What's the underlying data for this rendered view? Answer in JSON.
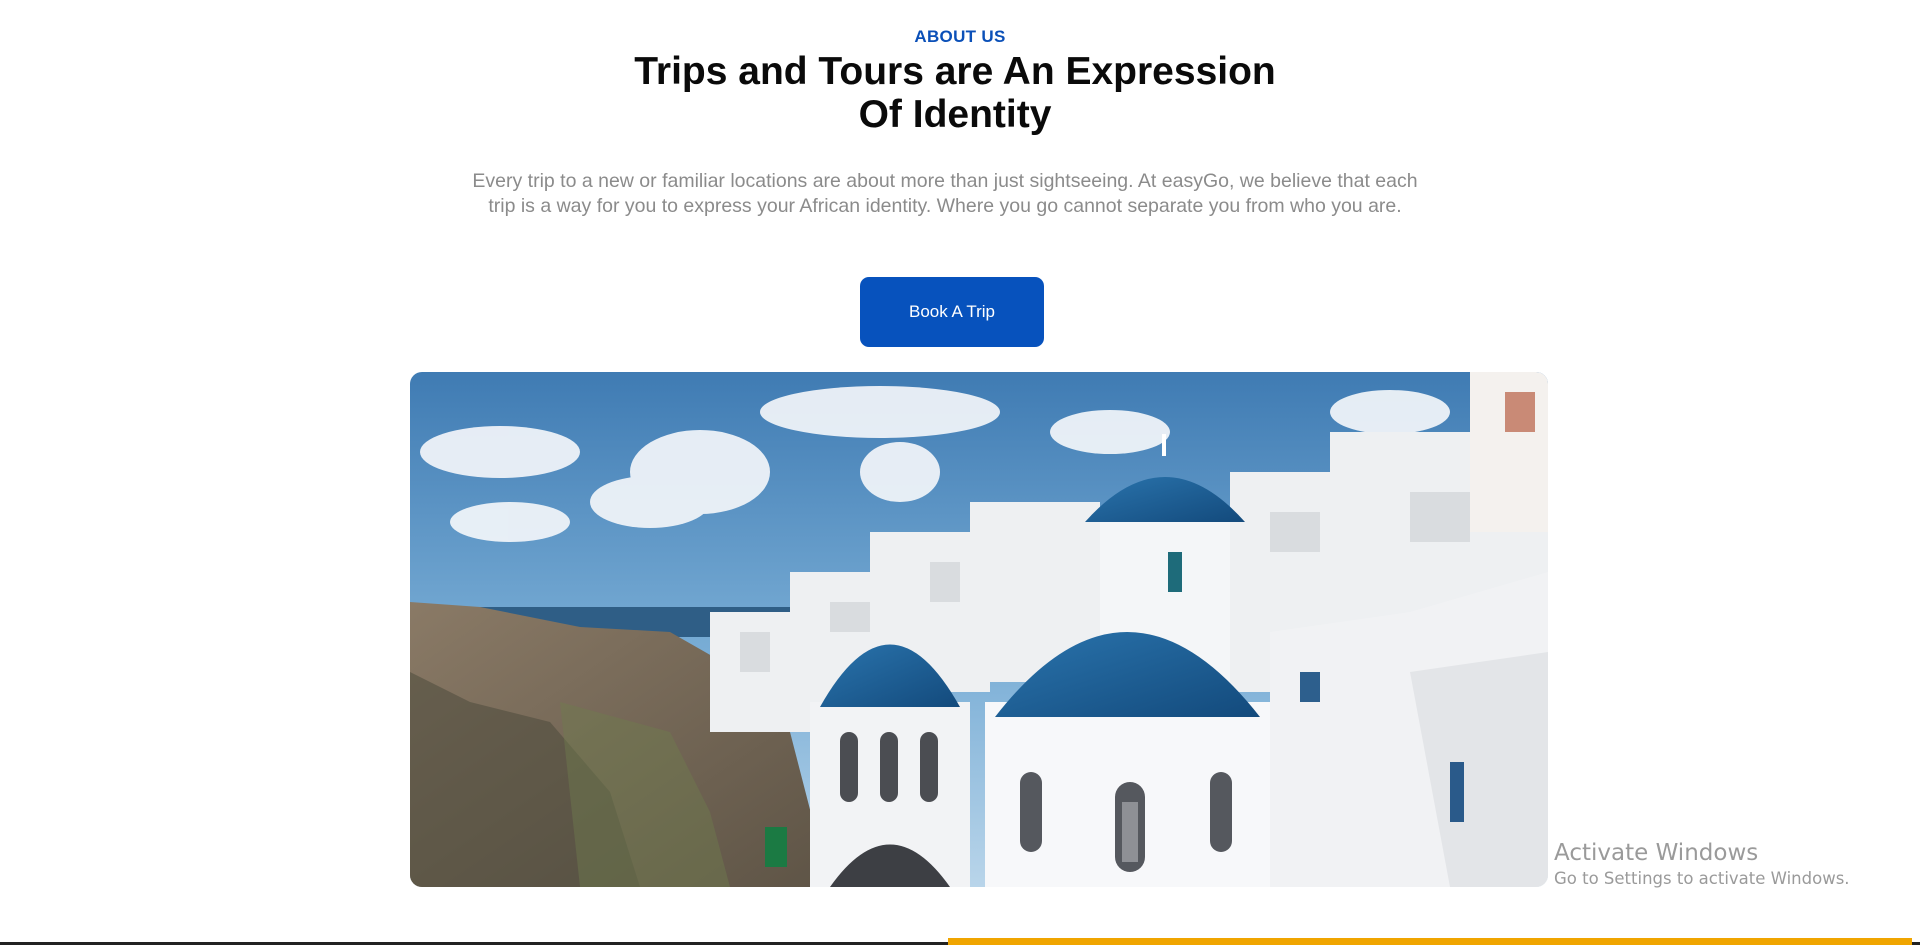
{
  "about": {
    "eyebrow": "ABOUT US",
    "title_line_1": "Trips and Tours are An Expression",
    "title_line_2": "Of Identity",
    "description": "Every trip to a new or familiar locations are about more than just sightseeing. At easyGo, we believe that each trip is a way for you to express your African identity. Where you go cannot separate you from who you are.",
    "cta_label": "Book A Trip"
  },
  "hero": {
    "subject": "Santorini blue-domed churches"
  },
  "watermark": {
    "title": "Activate Windows",
    "subtitle": "Go to Settings to activate Windows."
  },
  "colors": {
    "accent": "#0752bd",
    "eyebrow": "#0b50b8",
    "highlight_bar": "#f0a500",
    "dome_blue": "#1d5f96"
  }
}
